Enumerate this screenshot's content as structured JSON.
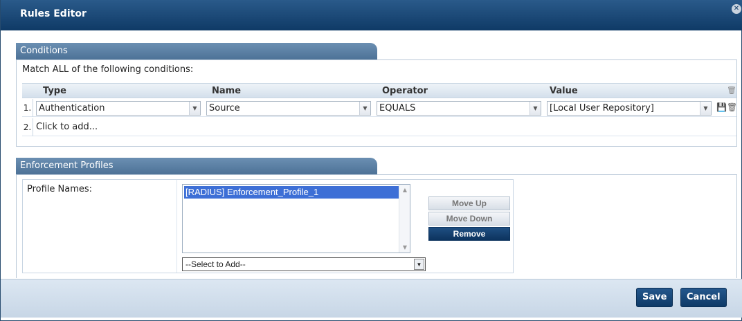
{
  "window": {
    "title": "Rules Editor",
    "close_glyph": "✕"
  },
  "conditions": {
    "tab_label": "Conditions",
    "match_text": "Match ALL of the following conditions:",
    "headers": {
      "type": "Type",
      "name": "Name",
      "operator": "Operator",
      "value": "Value"
    },
    "rows": [
      {
        "num": "1.",
        "type": "Authentication",
        "name": "Source",
        "operator": "EQUALS",
        "value": "[Local User Repository]"
      }
    ],
    "add_row": {
      "num": "2.",
      "label": "Click to add..."
    }
  },
  "enforcement": {
    "tab_label": "Enforcement Profiles",
    "profile_names_label": "Profile Names:",
    "profiles": [
      "[RADIUS] Enforcement_Profile_1"
    ],
    "add_select": "--Select to Add--",
    "buttons": {
      "move_up": "Move Up",
      "move_down": "Move Down",
      "remove": "Remove"
    }
  },
  "footer": {
    "save": "Save",
    "cancel": "Cancel"
  },
  "icons": {
    "trash": "🗑",
    "save": "💾",
    "dropdown": "▼",
    "scroll_up": "▲",
    "scroll_down": "▼"
  },
  "colors": {
    "title_bar": "#0f3a66",
    "tab": "#5a7fa4",
    "selection": "#3d6fd6",
    "footer": "#d0dde9"
  }
}
